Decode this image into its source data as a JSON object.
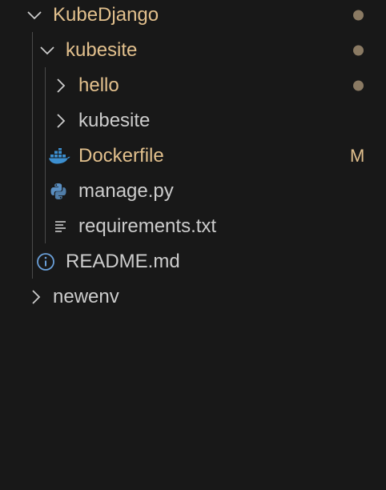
{
  "explorer": {
    "items": [
      {
        "label": "KubeDjango",
        "type": "folder",
        "expanded": true,
        "depth": 0,
        "status": "modified",
        "decoration": "dot",
        "icon": "chevron-down-icon"
      },
      {
        "label": "kubesite",
        "type": "folder",
        "expanded": true,
        "depth": 1,
        "status": "modified",
        "decoration": "dot",
        "icon": "chevron-down-icon"
      },
      {
        "label": "hello",
        "type": "folder",
        "expanded": false,
        "depth": 2,
        "status": "modified",
        "decoration": "dot",
        "icon": "chevron-right-icon"
      },
      {
        "label": "kubesite",
        "type": "folder",
        "expanded": false,
        "depth": 2,
        "status": "normal",
        "icon": "chevron-right-icon"
      },
      {
        "label": "Dockerfile",
        "type": "file",
        "depth": 2,
        "status": "modified",
        "badge": "M",
        "icon": "docker-icon"
      },
      {
        "label": "manage.py",
        "type": "file",
        "depth": 2,
        "status": "normal",
        "icon": "python-icon"
      },
      {
        "label": "requirements.txt",
        "type": "file",
        "depth": 2,
        "status": "normal",
        "icon": "text-file-icon"
      },
      {
        "label": "README.md",
        "type": "file",
        "depth": 1,
        "status": "normal",
        "icon": "info-icon"
      },
      {
        "label": "newenv",
        "type": "folder",
        "expanded": false,
        "depth": 0,
        "status": "normal",
        "icon": "chevron-right-icon"
      }
    ]
  },
  "colors": {
    "background": "#181818",
    "modified_text": "#e2c08d",
    "normal_text": "#cccccc",
    "decoration_dot": "#8a7a63",
    "docker_blue": "#3c8fd0",
    "python_blue": "#5a8fc2",
    "info_blue": "#6a9fd8",
    "indent_guide": "#4a4a4a"
  }
}
